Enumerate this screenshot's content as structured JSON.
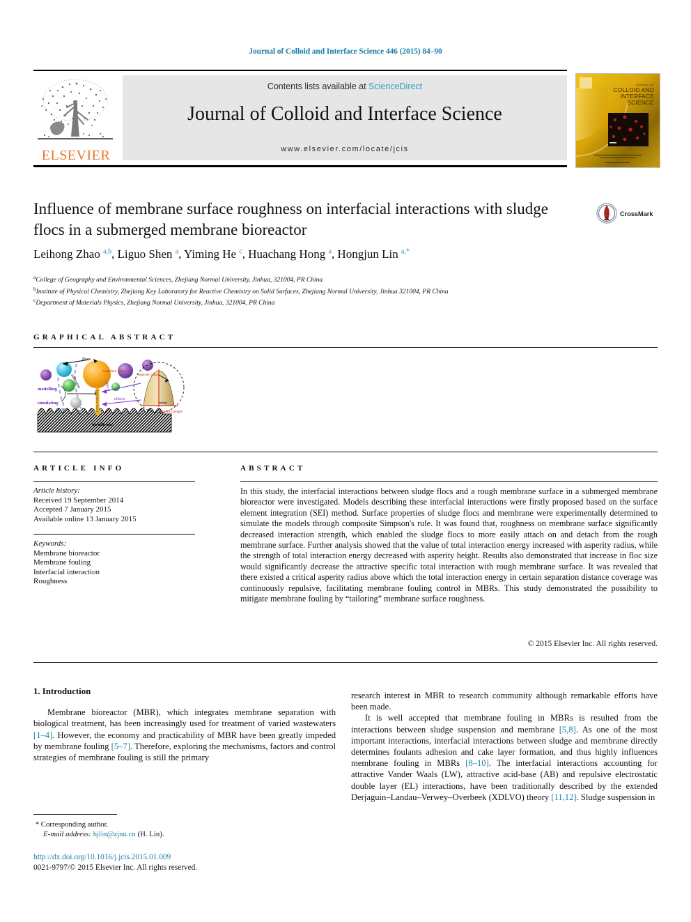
{
  "running_head": "Journal of Colloid and Interface Science 446 (2015) 84–90",
  "masthead": {
    "contents_prefix": "Contents lists available at ",
    "sciencedirect": "ScienceDirect",
    "journal_title": "Journal of Colloid and Interface Science",
    "journal_url": "www.elsevier.com/locate/jcis",
    "publisher": "ELSEVIER",
    "cover_line1": "JOURNAL OF",
    "cover_line2": "COLLOID AND",
    "cover_line3": "INTERFACE",
    "cover_line4": "SCIENCE"
  },
  "article": {
    "title": "Influence of membrane surface roughness on interfacial interactions with sludge flocs in a submerged membrane bioreactor",
    "crossmark_label": "CrossMark",
    "authors_html": "Leihong Zhao <sup>a,b</sup>, Liguo Shen <sup>a</sup>, Yiming He <sup>c</sup>, Huachang Hong <sup>a</sup>, Hongjun Lin <sup>a,*</sup>",
    "affiliations": [
      "College of Geography and Environmental Sciences, Zhejiang Normal University, Jinhua, 321004, PR China",
      "Institute of Physical Chemistry, Zhejiang Key Laboratory for Reactive Chemistry on Solid Surfaces, Zhejiang Normal University, Jinhua 321004, PR China",
      "Department of Materials Physics, Zhejiang Normal University, Jinhua, 321004, PR China"
    ],
    "affil_marks": [
      "a",
      "b",
      "c"
    ]
  },
  "graphical_abstract": {
    "heading": "GRAPHICAL ABSTRACT",
    "labels": {
      "flocs": "flocs",
      "adhesion": "adhesion",
      "modelling": "modelling",
      "simulating": "simulating",
      "interface_force": "interface force",
      "effects": "effects",
      "asperity_radius": "asperity radius",
      "asperity_height": "asperity height",
      "membrane": "membrane"
    }
  },
  "article_info": {
    "heading": "ARTICLE INFO",
    "history_label": "Article history:",
    "history": [
      "Received 19 September 2014",
      "Accepted 7 January 2015",
      "Available online 13 January 2015"
    ],
    "keywords_label": "Keywords:",
    "keywords": [
      "Membrane bioreactor",
      "Membrane fouling",
      "Interfacial interaction",
      "Roughness"
    ]
  },
  "abstract": {
    "heading": "ABSTRACT",
    "text": "In this study, the interfacial interactions between sludge flocs and a rough membrane surface in a submerged membrane bioreactor were investigated. Models describing these interfacial interactions were firstly proposed based on the surface element integration (SEI) method. Surface properties of sludge flocs and membrane were experimentally determined to simulate the models through composite Simpson's rule. It was found that, roughness on membrane surface significantly decreased interaction strength, which enabled the sludge flocs to more easily attach on and detach from the rough membrane surface. Further analysis showed that the value of total interaction energy increased with asperity radius, while the strength of total interaction energy decreased with asperity height. Results also demonstrated that increase in floc size would significantly decrease the attractive specific total interaction with rough membrane surface. It was revealed that there existed a critical asperity radius above which the total interaction energy in certain separation distance coverage was continuously repulsive, facilitating membrane fouling control in MBRs. This study demonstrated the possibility to mitigate membrane fouling by “tailoring” membrane surface roughness.",
    "copyright": "© 2015 Elsevier Inc. All rights reserved."
  },
  "body": {
    "section_number_title": "1. Introduction",
    "left_paragraph_html": "Membrane bioreactor (MBR), which integrates membrane separation with biological treatment, has been increasingly used for treatment of varied wastewaters <span class=\"ref\">[1–4]</span>. However, the economy and practicability of MBR have been greatly impeded by membrane fouling <span class=\"ref\">[5–7]</span>. Therefore, exploring the mechanisms, factors and control strategies of membrane fouling is still the primary",
    "right_paragraph1_html": "research interest in MBR to research community although remarkable efforts have been made.",
    "right_paragraph2_html": "It is well accepted that membrane fouling in MBRs is resulted from the interactions between sludge suspension and membrane <span class=\"ref\">[5,8]</span>. As one of the most important interactions, interfacial interactions between sludge and membrane directly determines foulants adhesion and cake layer formation, and thus highly influences membrane fouling in MBRs <span class=\"ref\">[8–10]</span>. The interfacial interactions accounting for attractive Vander Waals (LW), attractive acid-base (AB) and repulsive electrostatic double layer (EL) interactions, have been traditionally described by the extended Derjaguin–Landau–Verwey–Overbeek (XDLVO) theory <span class=\"ref\">[11,12]</span>. Sludge suspension in"
  },
  "footer": {
    "corresponding_marker": "*",
    "corresponding_label": "Corresponding author.",
    "email_label": "E-mail address:",
    "email": "hjlin@zjnu.cn",
    "email_suffix": "(H. Lin).",
    "doi_url": "http://dx.doi.org/10.1016/j.jcis.2015.01.009",
    "issn_line": "0021-9797/© 2015 Elsevier Inc. All rights reserved."
  },
  "colors": {
    "link_blue": "#1b7fa8",
    "sciencedirect_blue": "#2e9ec4",
    "elsevier_orange": "#e87722",
    "band_grey": "#e6e6e6"
  }
}
